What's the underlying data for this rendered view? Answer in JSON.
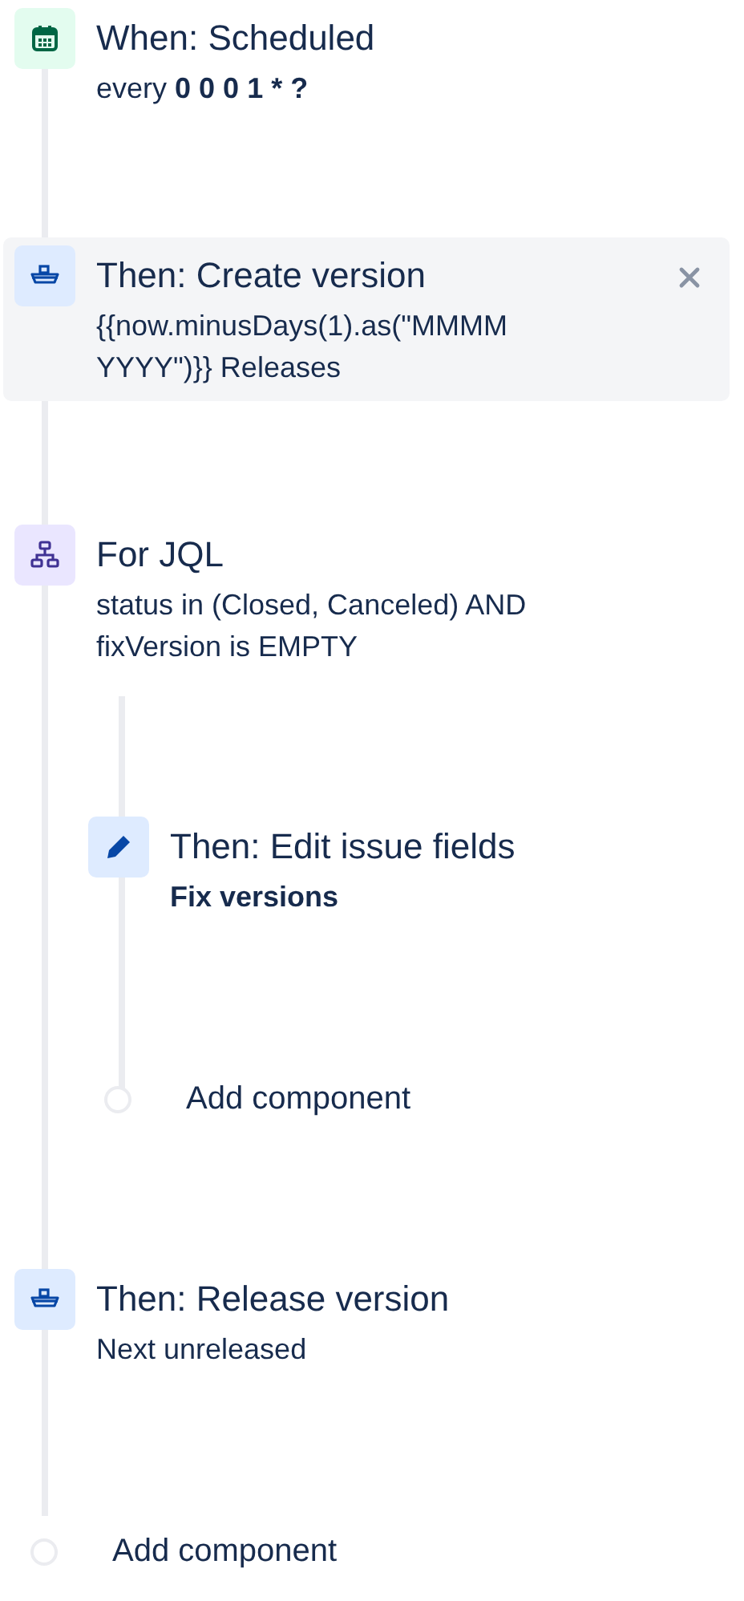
{
  "rule": [
    {
      "kind": "trigger",
      "selected": false,
      "title": "When: Scheduled",
      "description": [
        {
          "text": "every ",
          "bold": false
        },
        {
          "text": "0 0 0 1 * ?",
          "bold": true
        }
      ]
    },
    {
      "kind": "version",
      "selected": true,
      "title": "Then: Create version",
      "description": [
        {
          "text": "{{now.minusDays(1).as(\"MMMM YYYY\")}} Releases",
          "bold": false
        }
      ]
    },
    {
      "kind": "branch",
      "selected": false,
      "title": "For JQL",
      "description": [
        {
          "text": "status in (Closed, Canceled) AND fixVersion is EMPTY",
          "bold": false
        }
      ],
      "children": [
        {
          "kind": "edit",
          "selected": false,
          "title": "Then: Edit issue fields",
          "description": [
            {
              "text": "Fix versions",
              "bold": true
            }
          ]
        },
        {
          "kind": "add",
          "label": "Add component"
        }
      ]
    },
    {
      "kind": "version",
      "selected": false,
      "title": "Then: Release version",
      "description": [
        {
          "text": "Next unreleased",
          "bold": false
        }
      ]
    },
    {
      "kind": "add",
      "label": "Add component"
    }
  ]
}
